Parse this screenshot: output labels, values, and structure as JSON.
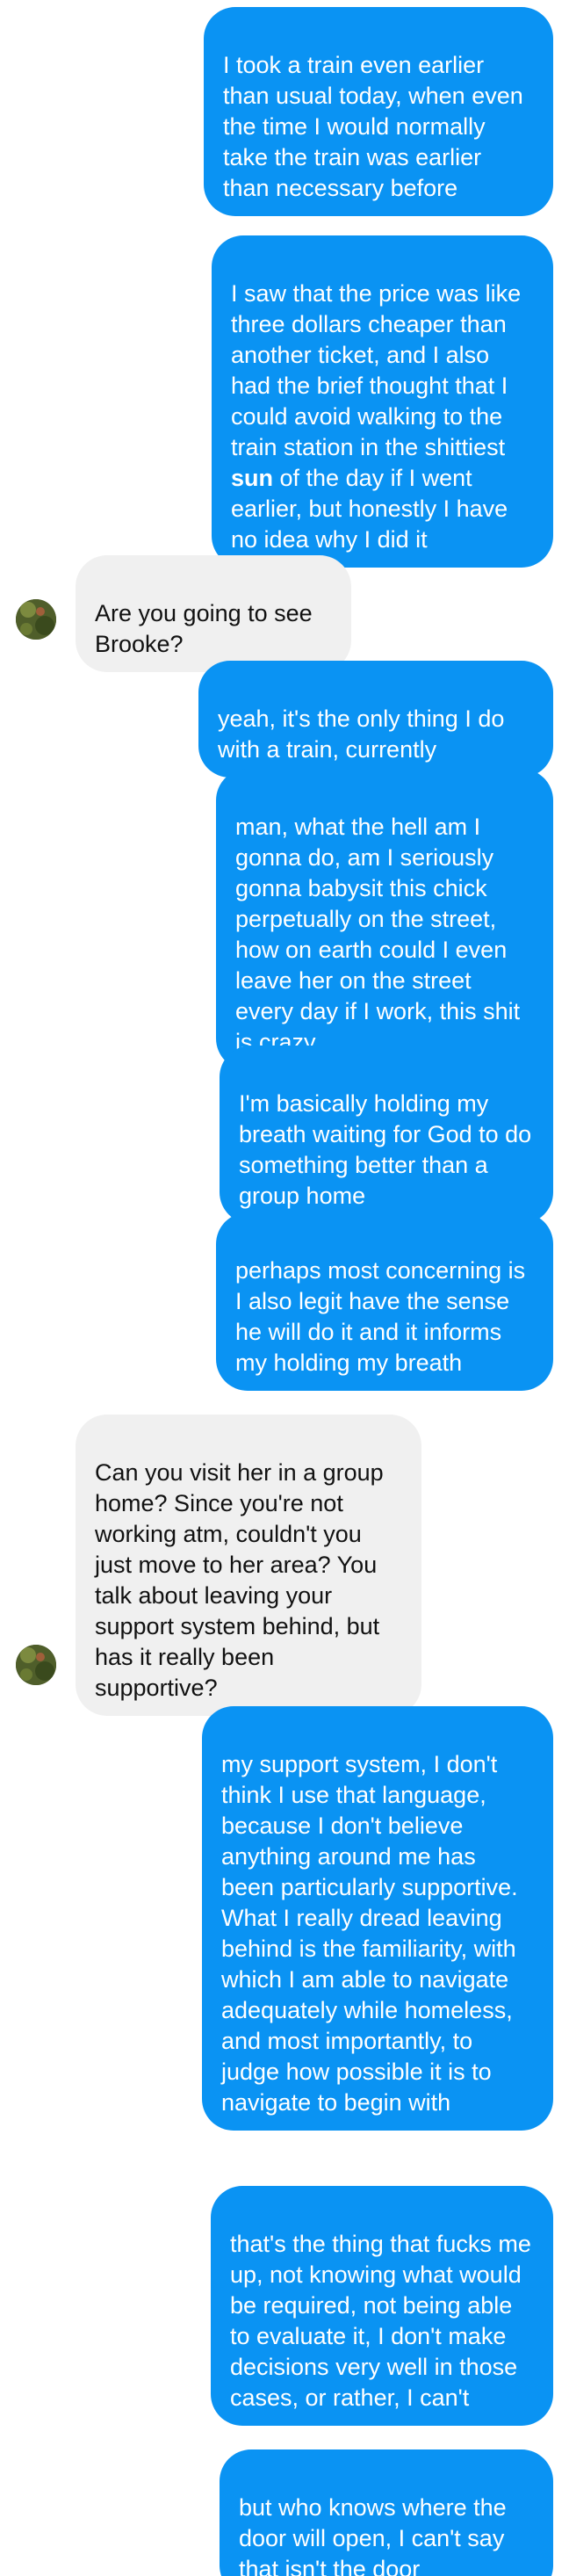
{
  "messages": [
    {
      "side": "out",
      "text": "I took a train even earlier than usual today, when even the time I would normally take the train was earlier than necessary before"
    },
    {
      "side": "out",
      "text_before": "I saw that the price was like three dollars cheaper than another ticket, and I also had the brief thought that I could avoid walking to the train station in the shittiest ",
      "text_bold": "sun",
      "text_after": " of the day if I went earlier, but honestly I have no idea why I did it"
    },
    {
      "side": "in",
      "text": "Are you going to see Brooke?"
    },
    {
      "side": "out",
      "text": "yeah, it's the only thing I do with a train, currently"
    },
    {
      "side": "out",
      "text": "man, what the hell am I gonna do, am I seriously gonna babysit this chick perpetually on the street, how on earth could I even leave her on the street every day if I work, this shit is crazy"
    },
    {
      "side": "out",
      "text": "I'm basically holding my breath waiting for God to do something better than a group home"
    },
    {
      "side": "out",
      "text": "perhaps most concerning is I also legit have the sense he will do it and it informs my holding my breath"
    },
    {
      "side": "in",
      "text": "Can you visit her in a group home? Since you're not working atm, couldn't you just move to her area? You talk about leaving your support system behind, but has it really been supportive?"
    },
    {
      "side": "out",
      "text": "my support system, I don't think I use that language, because I don't believe anything around me has been particularly supportive. What I really dread leaving behind is the familiarity, with which I am able to navigate adequately while homeless, and most importantly, to judge how possible it is to navigate to begin with"
    },
    {
      "side": "out",
      "text": "that's the thing that fucks me up, not knowing what would be required, not being able to evaluate it, I don't make decisions very well in those cases, or rather, I can't"
    },
    {
      "side": "out",
      "text": "but who knows where the door will open, I can't say that isn't the door"
    }
  ],
  "colors": {
    "outgoing_bubble": "#0a93f3",
    "incoming_bubble": "#f0f0f0",
    "outgoing_text": "#ffffff",
    "incoming_text": "#111111"
  },
  "avatar": {
    "icon": "contact-avatar-icon"
  }
}
